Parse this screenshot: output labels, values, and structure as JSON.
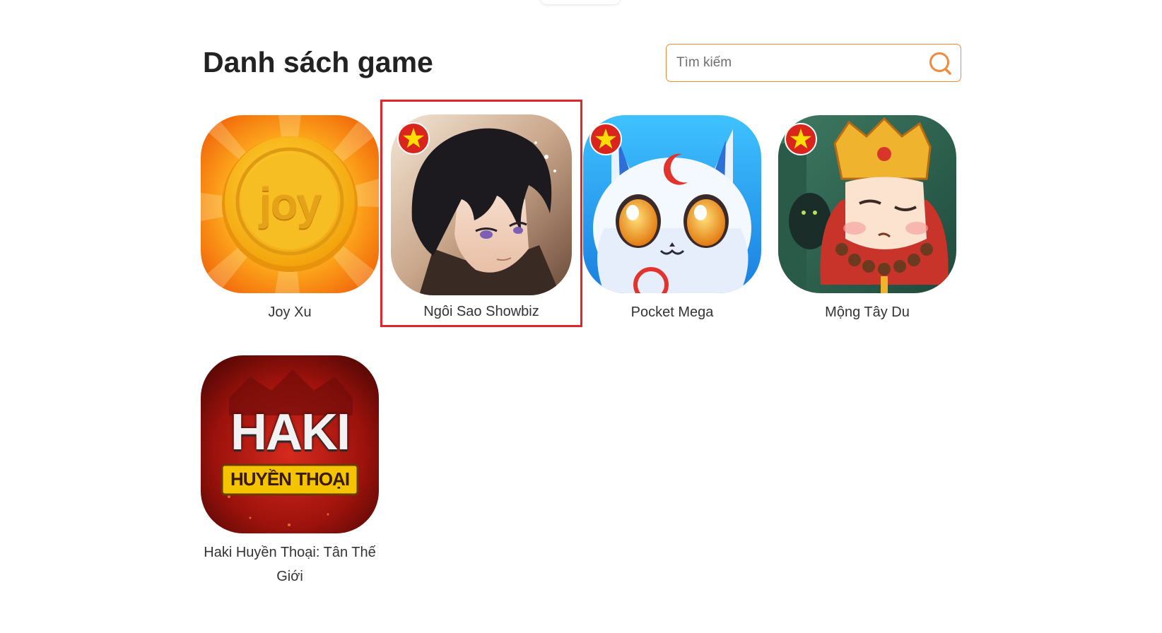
{
  "page": {
    "title": "Danh sách game"
  },
  "search": {
    "placeholder": "Tìm kiếm",
    "value": ""
  },
  "games": [
    {
      "name": "Joy Xu",
      "logo_text": "joy",
      "badge": false
    },
    {
      "name": "Ngôi Sao Showbiz",
      "badge": true,
      "selected": true
    },
    {
      "name": "Pocket Mega",
      "badge": true
    },
    {
      "name": "Mộng Tây Du",
      "badge": true
    },
    {
      "name": "Haki Huyền Thoại: Tân Thế Giới",
      "logo_text_top": "HAKI",
      "logo_text_bottom": "HUYỀN THOẠI",
      "badge": false
    }
  ],
  "colors": {
    "accent": "#f08a3c",
    "selection": "#e0262b",
    "badge_red": "#da251d",
    "badge_star": "#ffde00"
  },
  "icons": {
    "search": "search-icon",
    "badge": "vietnam-flag-badge"
  }
}
